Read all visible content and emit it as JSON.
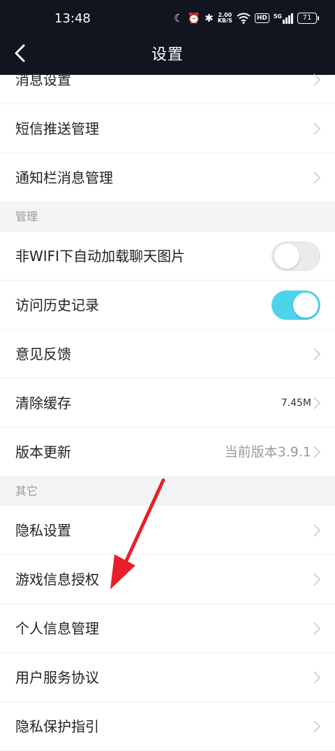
{
  "status_bar": {
    "time": "13:48",
    "speed_value": "2.00",
    "speed_unit": "KB/S",
    "hd": "HD",
    "network": "5G",
    "battery": "71"
  },
  "header": {
    "title": "设置"
  },
  "rows_top": [
    {
      "label": "消息设置"
    },
    {
      "label": "短信推送管理"
    },
    {
      "label": "通知栏消息管理"
    }
  ],
  "section_manage": {
    "label": "管理"
  },
  "toggle_rows": [
    {
      "label": "非WIFI下自动加载聊天图片",
      "on": false
    },
    {
      "label": "访问历史记录",
      "on": true
    }
  ],
  "rows_manage": [
    {
      "label": "意见反馈"
    },
    {
      "label": "清除缓存",
      "value": "7.45M"
    },
    {
      "label": "版本更新",
      "value": "当前版本3.9.1"
    }
  ],
  "section_other": {
    "label": "其它"
  },
  "rows_other": [
    {
      "label": "隐私设置"
    },
    {
      "label": "游戏信息授权"
    },
    {
      "label": "个人信息管理"
    },
    {
      "label": "用户服务协议"
    },
    {
      "label": "隐私保护指引"
    }
  ],
  "colors": {
    "header_bg": "#10151f",
    "toggle_on": "#4cd4ea",
    "annotation_arrow": "#e8202a"
  }
}
